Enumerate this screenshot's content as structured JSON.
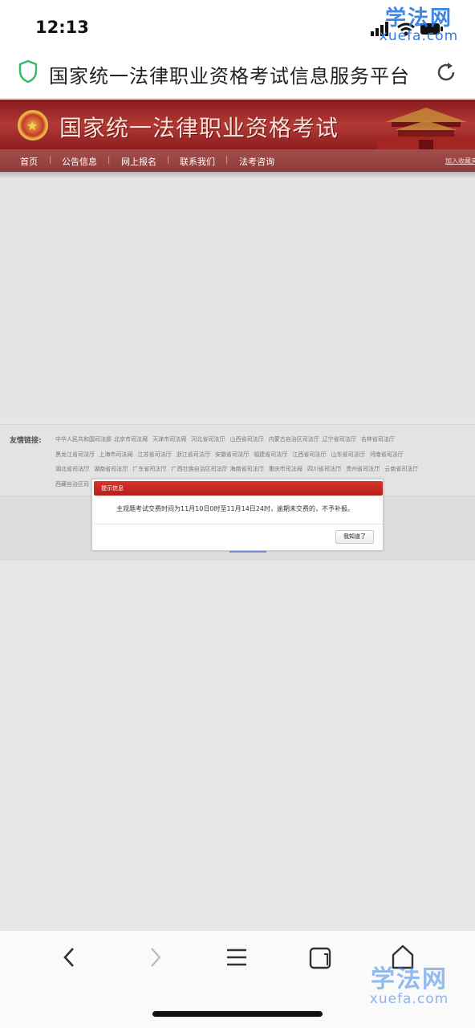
{
  "status_bar": {
    "time": "12:13"
  },
  "browser": {
    "site_title": "国家统一法律职业资格考试信息服务平台"
  },
  "watermark": {
    "cn": "学法网",
    "en": "xuefa.com"
  },
  "banner": {
    "title": "国家统一法律职业资格考试"
  },
  "nav": {
    "items": [
      "首页",
      "公告信息",
      "网上报名",
      "联系我们",
      "法考咨询"
    ],
    "favorite": "加入收藏夹"
  },
  "links": {
    "title": "友情链接:",
    "rows": [
      [
        "中华人民共和国司法部",
        "北京市司法局",
        "天津市司法局",
        "河北省司法厅",
        "山西省司法厅",
        "内蒙古自治区司法厅",
        "辽宁省司法厅",
        "吉林省司法厅"
      ],
      [
        "黑龙江省司法厅",
        "上海市司法局",
        "江苏省司法厅",
        "浙江省司法厅",
        "安徽省司法厅",
        "福建省司法厅",
        "江西省司法厅",
        "山东省司法厅",
        "河南省司法厅"
      ],
      [
        "湖北省司法厅",
        "湖南省司法厅",
        "广东省司法厅",
        "广西壮族自治区司法厅",
        "海南省司法厅",
        "重庆市司法局",
        "四川省司法厅",
        "贵州省司法厅",
        "云南省司法厅"
      ],
      [
        "西藏自治区司"
      ]
    ]
  },
  "dialog": {
    "title": "提示信息",
    "message": "主观题考试交费时间为11月10日0时至11月14日24时，逾期未交费的，不予补报。",
    "button": "我知道了"
  },
  "colors": {
    "banner_red": "#a8302e",
    "dialog_red": "#c9281f",
    "watermark_blue": "#2f7de3"
  },
  "icons": [
    "signal-icon",
    "wifi-icon",
    "battery-icon",
    "shield-icon",
    "reload-icon",
    "emblem-icon",
    "back-icon",
    "forward-icon",
    "menu-icon",
    "tabs-icon",
    "home-icon"
  ]
}
